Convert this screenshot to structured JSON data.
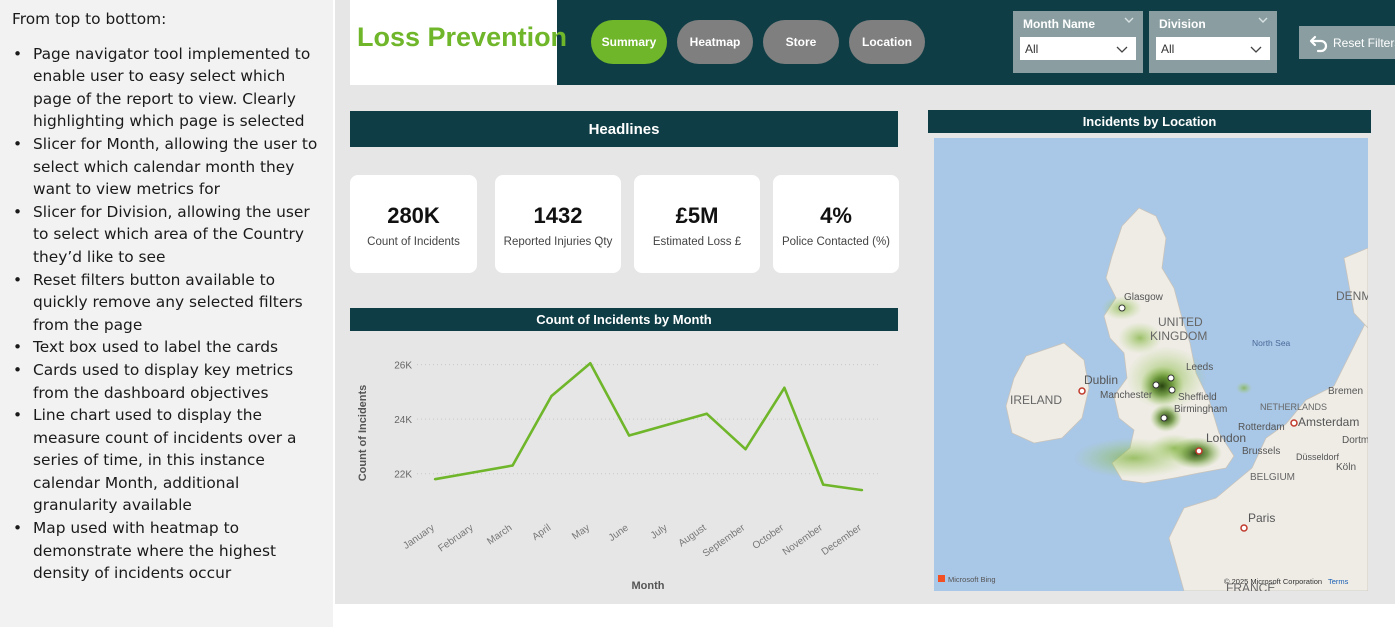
{
  "notes": {
    "intro": "From top to bottom:",
    "items": [
      "Page navigator tool implemented to enable user to easy select which page of the report to view. Clearly highlighting which page is selected",
      "Slicer for Month, allowing the user to select which calendar month they want to view metrics for",
      "Slicer for Division, allowing the user to select which area of the Country they’d like to see",
      "Reset filters button available to quickly remove any selected filters from the page",
      "Text box used to label the cards",
      "Cards used to display key metrics from the dashboard objectives",
      "Line chart used to display the measure count of incidents over a series of time, in this instance calendar Month, additional granularity available",
      "Map used with heatmap to demonstrate where the highest density of incidents occur"
    ]
  },
  "dashboard": {
    "title": "Loss Prevention",
    "nav": [
      {
        "label": "Summary",
        "active": true
      },
      {
        "label": "Heatmap",
        "active": false
      },
      {
        "label": "Store",
        "active": false
      },
      {
        "label": "Location",
        "active": false
      }
    ],
    "slicers": {
      "month": {
        "title": "Month Name",
        "value": "All"
      },
      "division": {
        "title": "Division",
        "value": "All"
      }
    },
    "reset_label": "Reset Filters",
    "headlines_title": "Headlines",
    "cards": [
      {
        "value": "280K",
        "label": "Count of Incidents"
      },
      {
        "value": "1432",
        "label": "Reported Injuries Qty"
      },
      {
        "value": "£5M",
        "label": "Estimated Loss £"
      },
      {
        "value": "4%",
        "label": "Police Contacted (%)"
      }
    ],
    "chart_title": "Count of Incidents by Month",
    "map_title": "Incidents by Location",
    "map_labels": {
      "glasgow": "Glasgow",
      "uk": "UNITED KINGDOM",
      "dublin": "Dublin",
      "ireland": "IRELAND",
      "manchester": "Manchester",
      "leeds": "Leeds",
      "sheffield": "Sheffield",
      "birmingham": "Birmingham",
      "london": "London",
      "north_sea": "North Sea",
      "netherlands": "NETHERLANDS",
      "amsterdam": "Amsterdam",
      "rotterdam": "Rotterdam",
      "bremen": "Bremen",
      "denmark": "DENM",
      "belgium": "BELGIUM",
      "brussels": "Brussels",
      "dusseldorf": "Düsseldorf",
      "dortmund": "Dortm",
      "koln": "Köln",
      "paris": "Paris",
      "france": "FRANCE",
      "attribution_left": "Microsoft Bing",
      "attribution_right": "© 2025 Microsoft Corporation",
      "terms": "Terms"
    },
    "colors": {
      "accent": "#6fb62a",
      "header": "#0e3d45",
      "slicer": "#8a9ea1",
      "nav_inactive": "#7f7f7f"
    }
  },
  "chart_data": {
    "type": "line",
    "title": "Count of Incidents by Month",
    "xlabel": "Month",
    "ylabel": "Count of Incidents",
    "categories": [
      "January",
      "February",
      "March",
      "April",
      "May",
      "June",
      "July",
      "August",
      "September",
      "October",
      "November",
      "December"
    ],
    "values": [
      21800,
      22050,
      22300,
      24850,
      26050,
      23400,
      23800,
      24200,
      22900,
      25150,
      21600,
      21400
    ],
    "yticks": [
      "22K",
      "24K",
      "26K"
    ],
    "ytick_values": [
      22000,
      24000,
      26000
    ],
    "ylim": [
      21000,
      26500
    ],
    "grid": true,
    "color": "#6fb62a"
  }
}
